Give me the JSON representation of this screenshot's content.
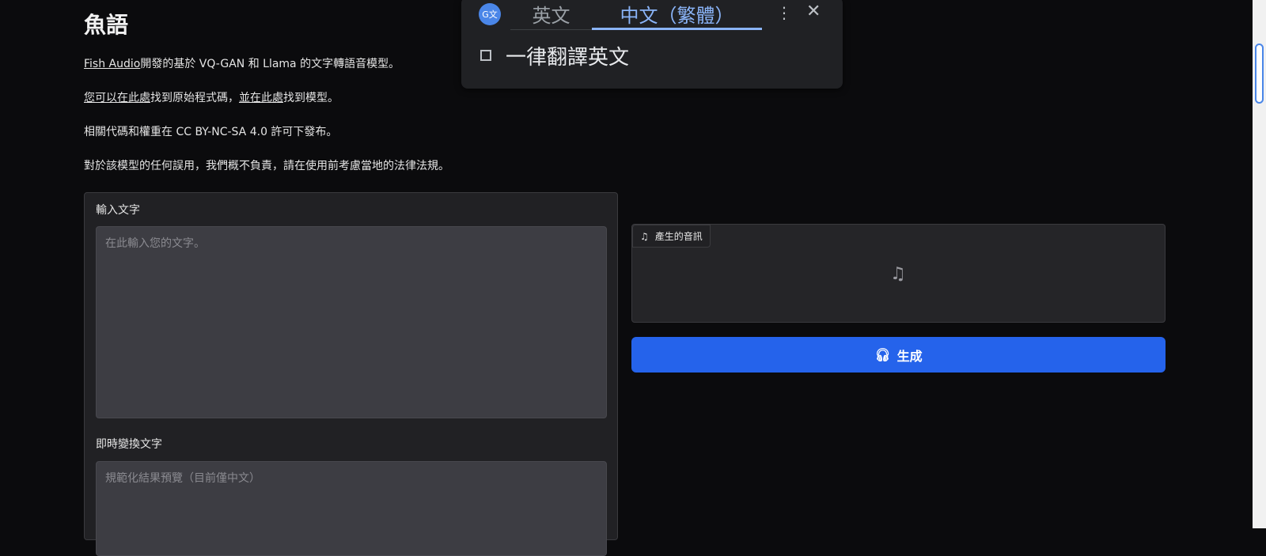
{
  "page": {
    "title": "魚語",
    "p1": {
      "link": "Fish Audio",
      "text": "開發的基於 VQ-GAN 和 Llama 的文字轉語音模型。"
    },
    "p2": {
      "link1": "您可以在此處",
      "text1": "找到原始程式碼，",
      "link2": "並在此處",
      "text2": "找到模型。"
    },
    "p3": "相關代碼和權重在 CC BY-NC-SA 4.0 許可下發布。",
    "p4": "對於該模型的任何誤用，我們概不負責，請在使用前考慮當地的法律法規。"
  },
  "input": {
    "label": "輸入文字",
    "placeholder": "在此輸入您的文字。"
  },
  "normalized": {
    "label": "即時變換文字",
    "placeholder": "規範化結果預覽（目前僅中文）"
  },
  "audio": {
    "label": "產生的音訊"
  },
  "generate": {
    "label": "生成"
  },
  "translate_popup": {
    "tab_source": "英文",
    "tab_target": "中文（繁體）",
    "checkbox_label": "一律翻譯英文",
    "checked": false
  }
}
